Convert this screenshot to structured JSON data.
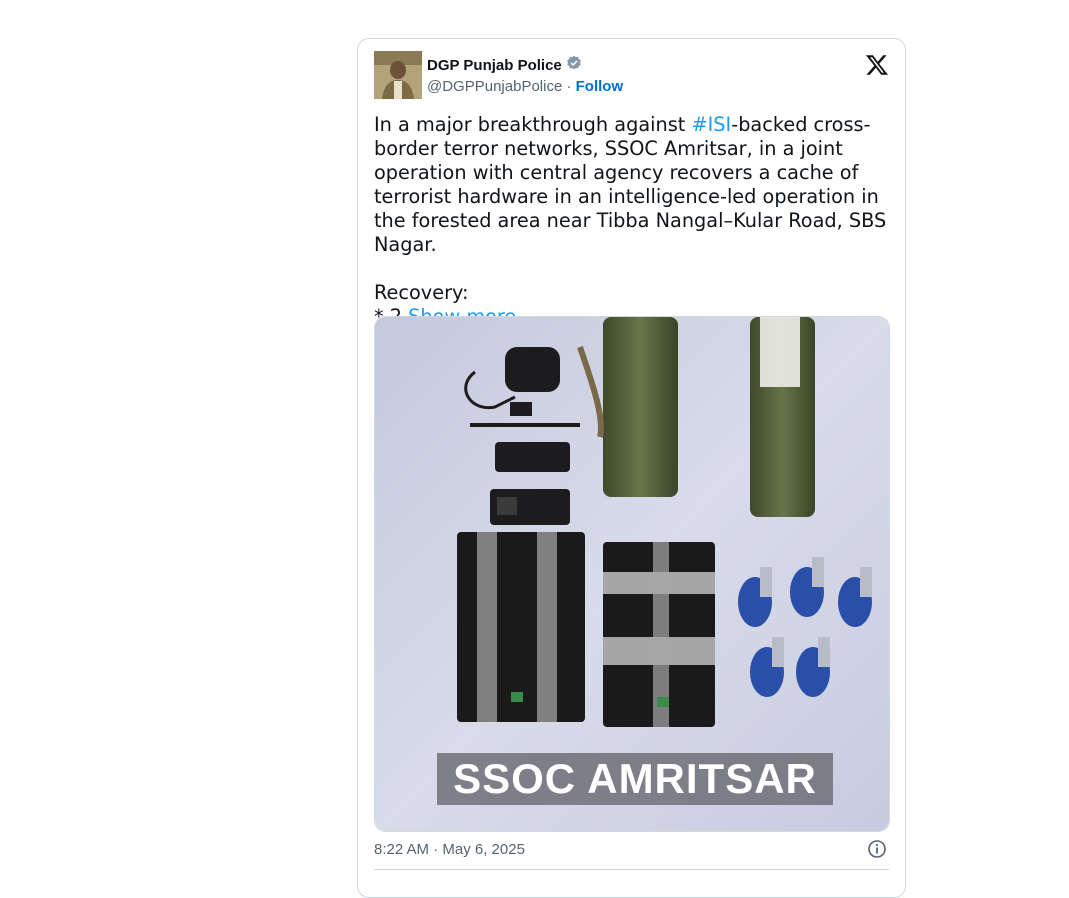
{
  "author": {
    "display_name": "DGP Punjab Police",
    "handle": "@DGPPunjabPolice",
    "separator": "·",
    "follow_label": "Follow",
    "verified_icon": "verified-badge-icon"
  },
  "platform_icon": "x-logo-icon",
  "tweet": {
    "text_part1": "In a major breakthrough against ",
    "hashtag": "#ISI",
    "text_part2": "-backed cross-border terror networks, SSOC Amritsar, in a joint operation with central agency recovers a cache of terrorist hardware in an intelligence-led operation in the forested area near Tibba Nangal–Kular Road, SBS Nagar.\n\nRecovery:\n* 2 ",
    "show_more_label": "Show more"
  },
  "media": {
    "caption": "SSOC AMRITSAR"
  },
  "footer": {
    "timestamp": "8:22 AM · May 6, 2025",
    "info_icon": "info-icon"
  },
  "colors": {
    "link": "#1d9bf0",
    "follow": "#006fd6",
    "text": "#0f1419",
    "secondary": "#536471",
    "border": "#cfd9de"
  }
}
